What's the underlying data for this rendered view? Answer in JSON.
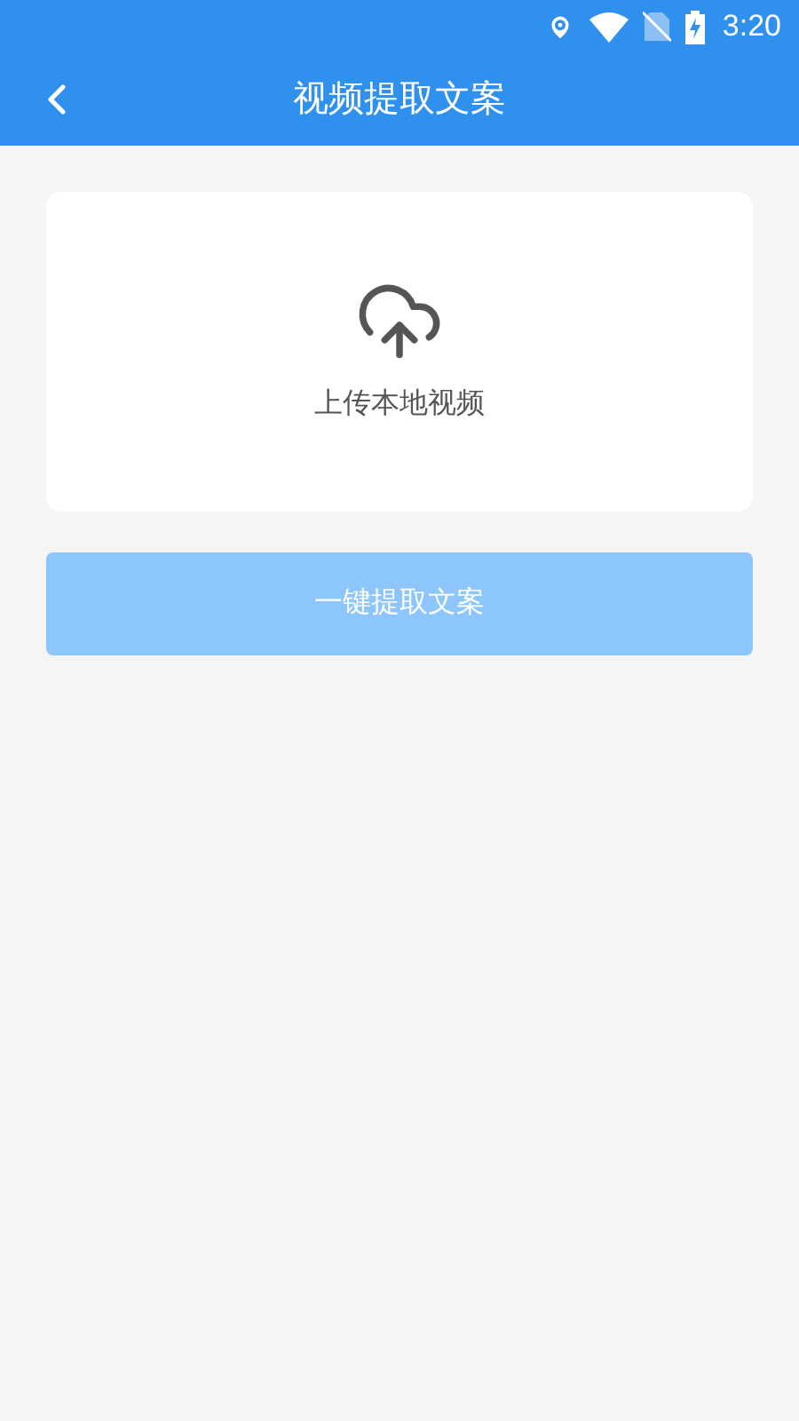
{
  "status_bar": {
    "time": "3:20"
  },
  "app_bar": {
    "title": "视频提取文案"
  },
  "upload_card": {
    "label": "上传本地视频"
  },
  "extract_button": {
    "label": "一键提取文案",
    "disabled": true
  }
}
